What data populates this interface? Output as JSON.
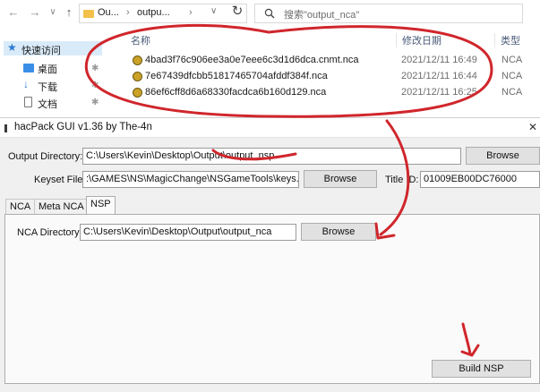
{
  "explorer": {
    "nav": {
      "back": "←",
      "forward": "→",
      "down": "∨",
      "up": "↑"
    },
    "breadcrumb": [
      "Ou...",
      "outpu..."
    ],
    "breadcrumb_sep": "›",
    "refresh": "↻",
    "search_placeholder": "搜索\"output_nca\"",
    "columns": {
      "name": "名称",
      "date": "修改日期",
      "type": "类型"
    },
    "files": [
      {
        "name": "4bad3f76c906ee3a0e7eee6c3d1d6dca.cnmt.nca",
        "date": "2021/12/11 16:49",
        "type": "NCA"
      },
      {
        "name": "7e67439dfcbb51817465704afddf384f.nca",
        "date": "2021/12/11 16:44",
        "type": "NCA"
      },
      {
        "name": "86ef6cff8d6a68330facdca6b160d129.nca",
        "date": "2021/12/11 16:25",
        "type": "NCA"
      }
    ],
    "sidebar": [
      {
        "label": "快速访问",
        "icon": "star-icon"
      },
      {
        "label": "桌面",
        "icon": "desktop-icon"
      },
      {
        "label": "下载",
        "icon": "download-icon"
      },
      {
        "label": "文档",
        "icon": "document-icon"
      }
    ]
  },
  "hacpack": {
    "title": "hacPack GUI v1.36 by The-4n",
    "close": "✕",
    "output_label": "Output Directory:",
    "output_value": "C:\\Users\\Kevin\\Desktop\\Output\\output_nsp",
    "keyset_label": "Keyset File:",
    "keyset_value": ":\\GAMES\\NS\\MagicChange\\NSGameTools\\keys.txt",
    "titleid_label": "Title ID:",
    "titleid_value": "01009EB00DC76000",
    "browse": "Browse",
    "tabs": [
      "NCA",
      "Meta NCA",
      "NSP"
    ],
    "nca_dir_label": "NCA Directory:",
    "nca_dir_value": "C:\\Users\\Kevin\\Desktop\\Output\\output_nca",
    "build_label": "Build NSP"
  },
  "colors": {
    "annotation": "#d0262c",
    "folder": "#f3c04a",
    "nca_icon": "#c9a227",
    "window_bg": "#f0f0f0",
    "button_bg": "#e1e1e1"
  }
}
